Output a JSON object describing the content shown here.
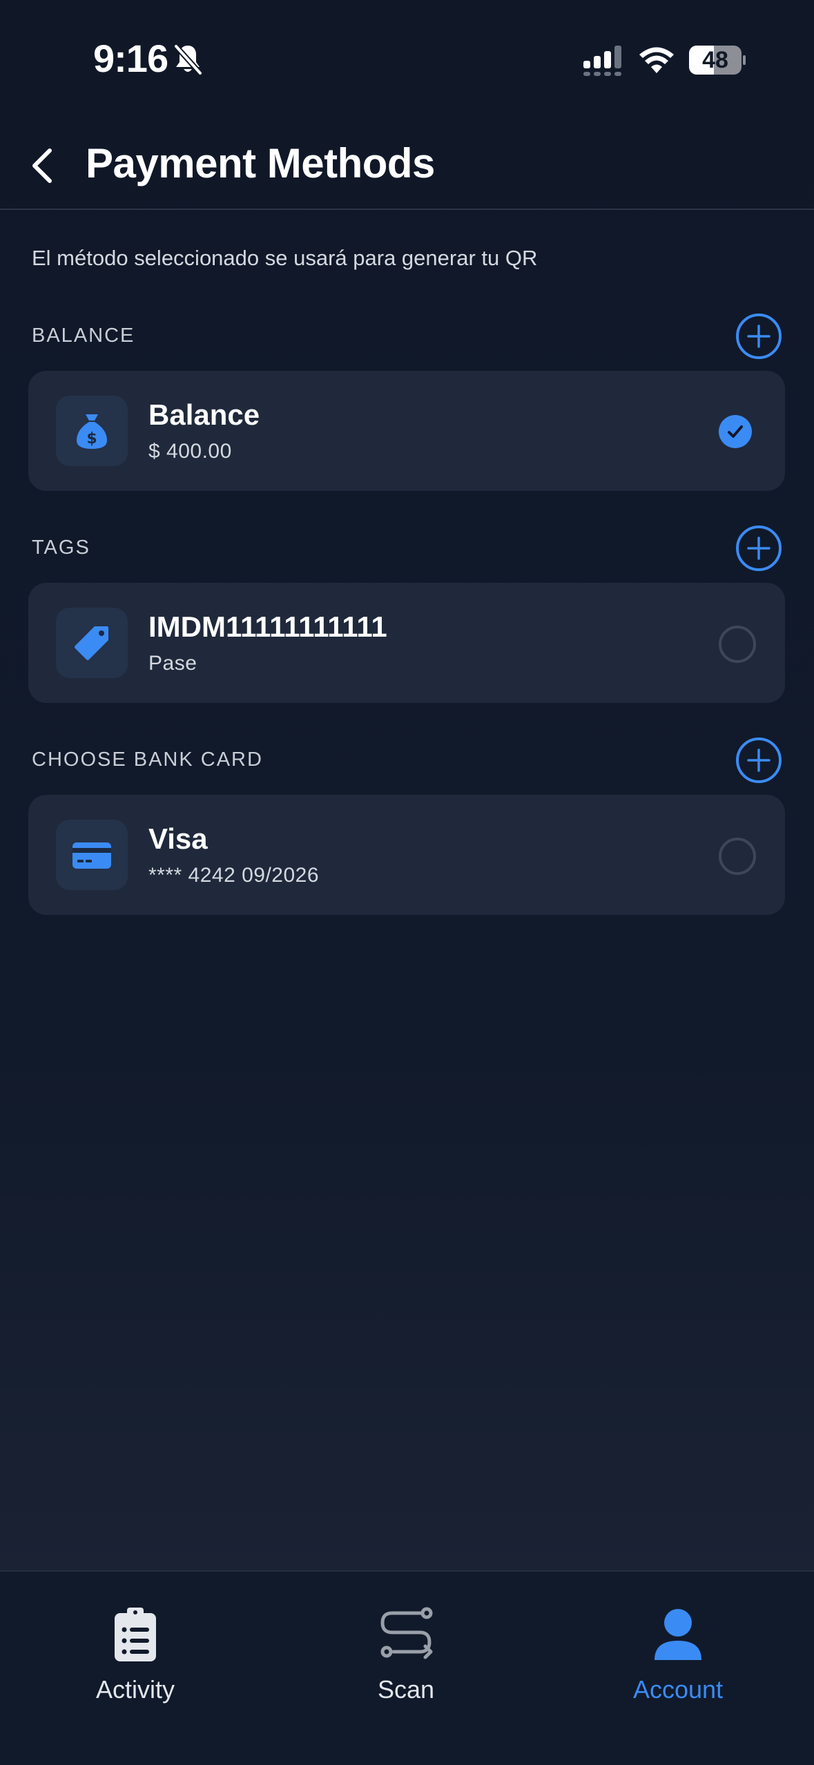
{
  "status_bar": {
    "time": "9:16",
    "battery": "48",
    "battery_level": 0.48
  },
  "header": {
    "title": "Payment Methods"
  },
  "subtitle": "El método seleccionado se usará para generar tu QR",
  "sections": {
    "balance": {
      "label": "BALANCE",
      "item": {
        "title": "Balance",
        "subtitle": "$ 400.00",
        "icon": "money-bag-icon",
        "selected": true
      }
    },
    "tags": {
      "label": "TAGS",
      "item": {
        "title": "IMDM11111111111",
        "subtitle": "Pase",
        "icon": "tag-icon",
        "selected": false
      }
    },
    "bank_card": {
      "label": "CHOOSE BANK CARD",
      "item": {
        "title": "Visa",
        "subtitle": "**** 4242  09/2026",
        "icon": "credit-card-icon",
        "selected": false
      }
    }
  },
  "tabbar": {
    "items": [
      {
        "label": "Activity",
        "icon": "clipboard-list-icon",
        "active": false
      },
      {
        "label": "Scan",
        "icon": "route-icon",
        "active": false
      },
      {
        "label": "Account",
        "icon": "user-icon",
        "active": true
      }
    ]
  },
  "colors": {
    "accent": "#3b8bf4",
    "background": "#101828",
    "card": "#1f293b"
  }
}
